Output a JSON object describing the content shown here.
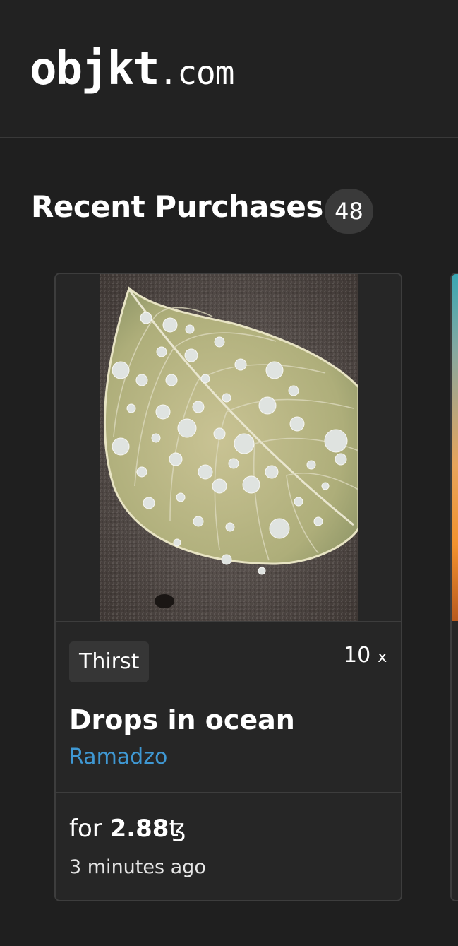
{
  "brand": {
    "logo_main": "objkt",
    "logo_tld": ".com"
  },
  "recent_purchases": {
    "title": "Recent Purchases",
    "count": "48"
  },
  "cards": [
    {
      "collection_tag": "Thirst",
      "edition_count": "10",
      "edition_suffix": "x",
      "title": "Drops in ocean",
      "artist": "Ramadzo",
      "price_prefix": "for",
      "price_amount": "2.88",
      "currency_symbol": "ꜩ",
      "time_ago": "3 minutes ago"
    }
  ],
  "colors": {
    "background": "#1f1f1f",
    "header": "#222222",
    "card": "#262626",
    "border": "#3d3d3d",
    "badge": "#3a3a3a",
    "link": "#3f98d3"
  }
}
